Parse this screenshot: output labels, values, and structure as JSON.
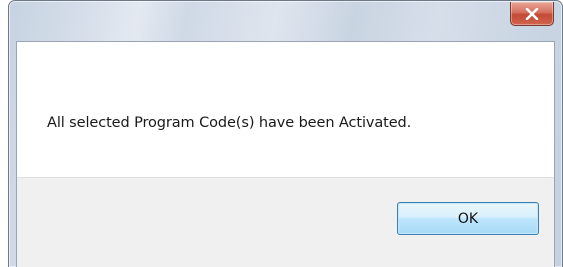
{
  "dialog": {
    "message": "All selected Program Code(s) have been Activated.",
    "ok_label": "OK",
    "close_icon": "close-icon"
  },
  "colors": {
    "close_button": "#c24a36",
    "ok_button_border": "#3c7fb1",
    "footer_background": "#f0f0f0"
  }
}
